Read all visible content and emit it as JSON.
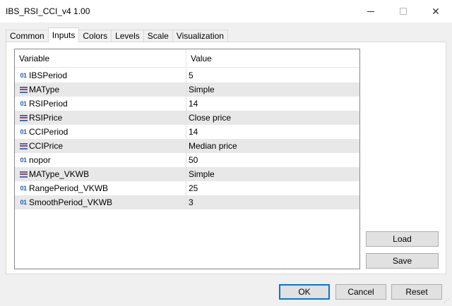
{
  "window": {
    "title": "IBS_RSI_CCI_v4 1.00",
    "minimize_glyph": "—",
    "close_glyph": "✕"
  },
  "tabs": [
    {
      "label": "Common",
      "active": false
    },
    {
      "label": "Inputs",
      "active": true
    },
    {
      "label": "Colors",
      "active": false
    },
    {
      "label": "Levels",
      "active": false
    },
    {
      "label": "Scale",
      "active": false
    },
    {
      "label": "Visualization",
      "active": false
    }
  ],
  "grid": {
    "headers": {
      "variable": "Variable",
      "value": "Value"
    },
    "rows": [
      {
        "icon": "int-icon",
        "icon_text": "01",
        "variable": "IBSPeriod",
        "value": "5"
      },
      {
        "icon": "enum-icon",
        "icon_text": "",
        "variable": "MAType",
        "value": "Simple"
      },
      {
        "icon": "int-icon",
        "icon_text": "01",
        "variable": "RSIPeriod",
        "value": "14"
      },
      {
        "icon": "enum-icon",
        "icon_text": "",
        "variable": "RSIPrice",
        "value": "Close price"
      },
      {
        "icon": "int-icon",
        "icon_text": "01",
        "variable": "CCIPeriod",
        "value": "14"
      },
      {
        "icon": "enum-icon",
        "icon_text": "",
        "variable": "CCIPrice",
        "value": "Median price"
      },
      {
        "icon": "int-icon",
        "icon_text": "01",
        "variable": "nopor",
        "value": "50"
      },
      {
        "icon": "enum-icon",
        "icon_text": "",
        "variable": "MAType_VKWB",
        "value": "Simple"
      },
      {
        "icon": "int-icon",
        "icon_text": "01",
        "variable": "RangePeriod_VKWB",
        "value": "25"
      },
      {
        "icon": "int-icon",
        "icon_text": "01",
        "variable": "SmoothPeriod_VKWB",
        "value": "3"
      }
    ]
  },
  "buttons": {
    "load": "Load",
    "save": "Save",
    "ok": "OK",
    "cancel": "Cancel",
    "reset": "Reset"
  },
  "colors": {
    "accent": "#0078d7",
    "int_icon": "#1f5fbf",
    "enum_icon_blue": "#3a6fc4",
    "enum_icon_red": "#c0392b"
  }
}
